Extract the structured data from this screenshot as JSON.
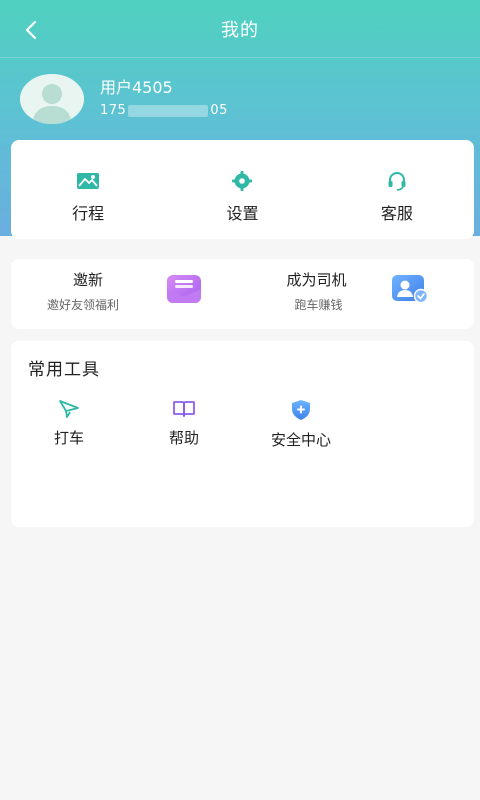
{
  "nav": {
    "title": "我的",
    "back_icon": "chevron-left-icon"
  },
  "profile": {
    "name": "用户4505",
    "phone_prefix": "175",
    "phone_suffix": "05"
  },
  "main_menu": [
    {
      "label": "行程",
      "icon": "trip-icon"
    },
    {
      "label": "设置",
      "icon": "gear-icon"
    },
    {
      "label": "客服",
      "icon": "headset-icon"
    }
  ],
  "promos": [
    {
      "title": "邀新",
      "subtitle": "邀好友领福利",
      "icon": "envelope-icon"
    },
    {
      "title": "成为司机",
      "subtitle": "跑车赚钱",
      "icon": "driver-card-icon"
    }
  ],
  "tools": {
    "title": "常用工具",
    "items": [
      {
        "label": "打车",
        "icon": "paper-plane-icon"
      },
      {
        "label": "帮助",
        "icon": "book-icon"
      },
      {
        "label": "安全中心",
        "icon": "shield-icon"
      }
    ]
  },
  "colors": {
    "accent": "#2fb8a6",
    "header_start": "#4fd1bf",
    "header_end": "#6aaee0",
    "purple": "#b76cf2",
    "blue": "#4b8ff0"
  }
}
